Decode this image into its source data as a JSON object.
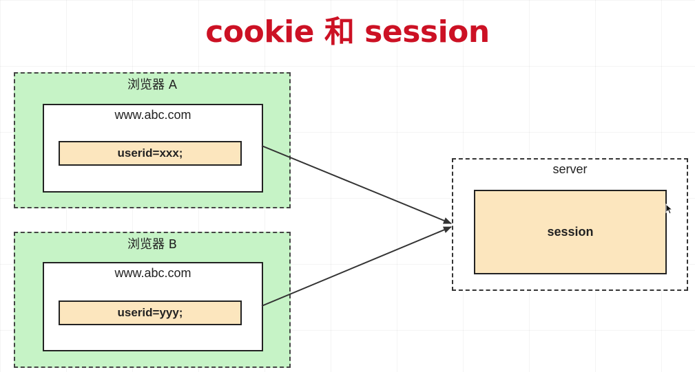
{
  "title": "cookie 和 session",
  "browser_a": {
    "label": "浏览器 A",
    "url": "www.abc.com",
    "cookie": "userid=xxx;"
  },
  "browser_b": {
    "label": "浏览器 B",
    "url": "www.abc.com",
    "cookie": "userid=yyy;"
  },
  "server": {
    "label": "server",
    "session": "session"
  },
  "colors": {
    "title": "#cc1124",
    "browser_fill": "#c6f3c6",
    "cookie_fill": "#fce6be"
  }
}
